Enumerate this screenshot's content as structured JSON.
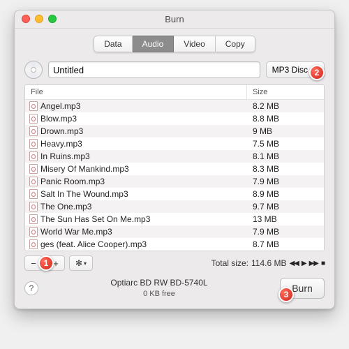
{
  "window": {
    "title": "Burn"
  },
  "tabs": {
    "data": "Data",
    "audio": "Audio",
    "video": "Video",
    "copy": "Copy",
    "active": "audio"
  },
  "disc": {
    "name": "Untitled",
    "type_label": "MP3 Disc"
  },
  "columns": {
    "file": "File",
    "size": "Size"
  },
  "files": [
    {
      "name": "Angel.mp3",
      "size": "8.2 MB"
    },
    {
      "name": "Blow.mp3",
      "size": "8.8 MB"
    },
    {
      "name": "Drown.mp3",
      "size": "9 MB"
    },
    {
      "name": "Heavy.mp3",
      "size": "7.5 MB"
    },
    {
      "name": "In Ruins.mp3",
      "size": "8.1 MB"
    },
    {
      "name": "Misery Of Mankind.mp3",
      "size": "8.3 MB"
    },
    {
      "name": "Panic Room.mp3",
      "size": "7.9 MB"
    },
    {
      "name": "Salt In The Wound.mp3",
      "size": "8.9 MB"
    },
    {
      "name": "The One.mp3",
      "size": "9.7 MB"
    },
    {
      "name": "The Sun Has Set On Me.mp3",
      "size": "13 MB"
    },
    {
      "name": "World War Me.mp3",
      "size": "7.9 MB"
    },
    {
      "name": "ges (feat. Alice Cooper).mp3",
      "size": "8.7 MB"
    }
  ],
  "footer": {
    "total_label": "Total size:",
    "total_value": "114.6 MB",
    "drive": "Optiarc BD RW BD-5740L",
    "free": "0 KB free",
    "burn_label": "Burn"
  },
  "callouts": {
    "one": "1",
    "two": "2",
    "three": "3"
  },
  "glyphs": {
    "minus": "−",
    "plus": "+",
    "gear": "✻",
    "help": "?",
    "chev": "▾",
    "prev": "◀◀",
    "play": "▶",
    "next": "▶▶",
    "stop": "■"
  }
}
